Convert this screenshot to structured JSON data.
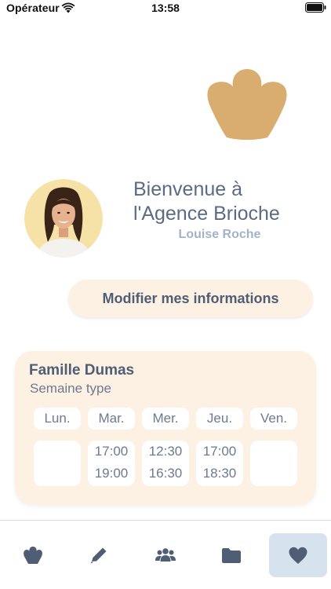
{
  "status_bar": {
    "carrier": "Opérateur",
    "time": "13:58"
  },
  "header": {
    "welcome_line1": "Bienvenue à",
    "welcome_line2": "l'Agence Brioche",
    "user_name": "Louise Roche"
  },
  "actions": {
    "modify_label": "Modifier mes informations"
  },
  "schedule": {
    "family": "Famille Dumas",
    "subtitle": "Semaine type",
    "days": [
      {
        "label": "Lun.",
        "start": "",
        "end": ""
      },
      {
        "label": "Mar.",
        "start": "17:00",
        "end": "19:00"
      },
      {
        "label": "Mer.",
        "start": "12:30",
        "end": "16:30"
      },
      {
        "label": "Jeu.",
        "start": "17:00",
        "end": "18:30"
      },
      {
        "label": "Ven.",
        "start": "",
        "end": ""
      }
    ]
  },
  "tabs": [
    {
      "icon": "brioche-icon",
      "active": false
    },
    {
      "icon": "pencil-icon",
      "active": false
    },
    {
      "icon": "users-icon",
      "active": false
    },
    {
      "icon": "folder-icon",
      "active": false
    },
    {
      "icon": "heart-icon",
      "active": true
    }
  ],
  "colors": {
    "accent": "#5b6b85",
    "secondary": "#a3b2c9",
    "card_background": "#fdf1e4",
    "logo": "#d9ad6f",
    "active_tab": "#d6e3ee"
  }
}
